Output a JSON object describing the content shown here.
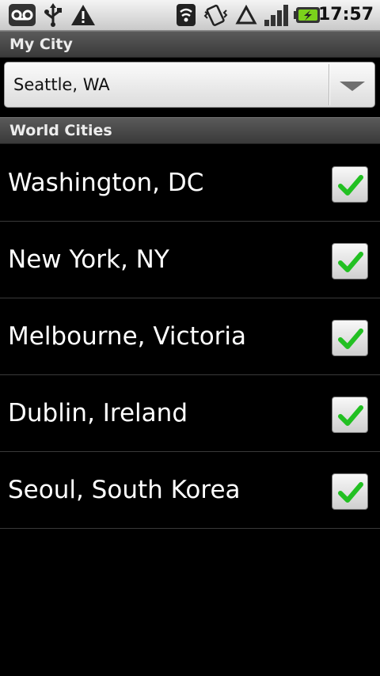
{
  "status_bar": {
    "time": "17:57",
    "icons": [
      "voicemail-icon",
      "usb-icon",
      "warning-icon",
      "wifi-icon",
      "vibrate-icon",
      "data-roaming-icon",
      "signal-icon",
      "battery-charging-icon"
    ]
  },
  "my_city": {
    "header": "My City",
    "selected": "Seattle, WA"
  },
  "world_cities": {
    "header": "World Cities",
    "items": [
      {
        "name": "Washington, DC",
        "checked": true
      },
      {
        "name": "New York, NY",
        "checked": true
      },
      {
        "name": "Melbourne, Victoria",
        "checked": true
      },
      {
        "name": "Dublin, Ireland",
        "checked": true
      },
      {
        "name": "Seoul, South Korea",
        "checked": true
      }
    ]
  },
  "colors": {
    "check": "#22c022",
    "background": "#000000"
  }
}
